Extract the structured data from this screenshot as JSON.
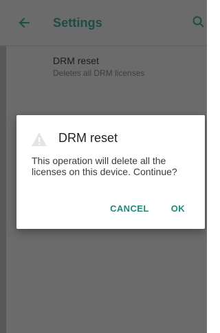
{
  "app_bar": {
    "title": "Settings",
    "back_icon": "arrow-back-icon",
    "search_icon": "search-icon",
    "title_color": "#1f4b45"
  },
  "preference": {
    "title": "DRM reset",
    "summary": "Deletes all DRM licenses"
  },
  "dialog": {
    "icon": "warning-icon",
    "title": "DRM reset",
    "message": "This operation will delete all the licenses on this device. Continue?",
    "cancel_label": "CANCEL",
    "ok_label": "OK",
    "accent_color": "#1d8a7c"
  },
  "scrim_color": "#6b6b6b"
}
